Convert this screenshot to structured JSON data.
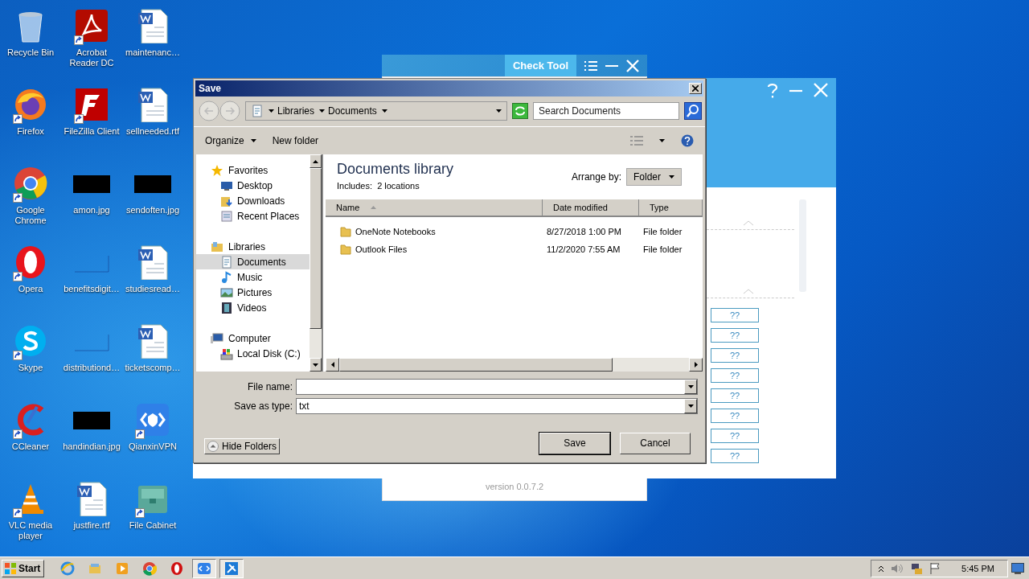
{
  "desktop_icons": [
    {
      "label": "Recycle Bin",
      "kind": "recycle",
      "shortcut": false
    },
    {
      "label": "Acrobat Reader DC",
      "kind": "pdf",
      "shortcut": true
    },
    {
      "label": "maintenanc…",
      "kind": "doc",
      "shortcut": false
    },
    {
      "label": "Firefox",
      "kind": "firefox",
      "shortcut": true
    },
    {
      "label": "FileZilla Client",
      "kind": "filezilla",
      "shortcut": true
    },
    {
      "label": "sellneeded.rtf",
      "kind": "doc",
      "shortcut": false
    },
    {
      "label": "Google Chrome",
      "kind": "chrome",
      "shortcut": true
    },
    {
      "label": "amon.jpg",
      "kind": "image",
      "shortcut": false
    },
    {
      "label": "sendoften.jpg",
      "kind": "image",
      "shortcut": false
    },
    {
      "label": "Opera",
      "kind": "opera",
      "shortcut": true
    },
    {
      "label": "benefitsdigit…",
      "kind": "blank",
      "shortcut": false
    },
    {
      "label": "studiesread…",
      "kind": "doc",
      "shortcut": false
    },
    {
      "label": "Skype",
      "kind": "skype",
      "shortcut": true
    },
    {
      "label": "distributiond…",
      "kind": "blank",
      "shortcut": false
    },
    {
      "label": "ticketscomp…",
      "kind": "doc",
      "shortcut": false
    },
    {
      "label": "CCleaner",
      "kind": "ccleaner",
      "shortcut": true
    },
    {
      "label": "handindian.jpg",
      "kind": "image",
      "shortcut": false
    },
    {
      "label": "QianxinVPN",
      "kind": "vpn",
      "shortcut": true
    },
    {
      "label": "VLC media player",
      "kind": "vlc",
      "shortcut": true
    },
    {
      "label": "justfire.rtf",
      "kind": "doc",
      "shortcut": false
    },
    {
      "label": "File Cabinet",
      "kind": "cabinet",
      "shortcut": true
    }
  ],
  "check_tool": {
    "title": "Check Tool",
    "version": "version 0.0.7.2"
  },
  "main_window": {
    "buttons": [
      "??",
      "??",
      "??",
      "??",
      "??",
      "??",
      "??",
      "??"
    ]
  },
  "save_dialog": {
    "title": "Save",
    "breadcrumb": [
      "Libraries",
      "Documents"
    ],
    "search": {
      "placeholder": "Search Documents"
    },
    "toolbar": [
      "Organize",
      "New folder"
    ],
    "nav": [
      {
        "label": "Favorites",
        "kind": "star",
        "children": [
          {
            "label": "Desktop",
            "kind": "desktop",
            "selected": false
          },
          {
            "label": "Downloads",
            "kind": "downloads",
            "selected": false
          },
          {
            "label": "Recent Places",
            "kind": "recent",
            "selected": false
          }
        ]
      },
      {
        "label": "Libraries",
        "kind": "library",
        "children": [
          {
            "label": "Documents",
            "kind": "documents",
            "selected": true
          },
          {
            "label": "Music",
            "kind": "music",
            "selected": false
          },
          {
            "label": "Pictures",
            "kind": "pictures",
            "selected": false
          },
          {
            "label": "Videos",
            "kind": "videos",
            "selected": false
          }
        ]
      },
      {
        "label": "Computer",
        "kind": "computer",
        "children": [
          {
            "label": "Local Disk (C:)",
            "kind": "disk",
            "selected": false
          }
        ]
      }
    ],
    "library": {
      "title": "Documents library",
      "subtitle": "Includes:  2 locations",
      "arrange_label": "Arrange by:",
      "arrange_value": "Folder"
    },
    "columns": [
      "Name",
      "Date modified",
      "Type"
    ],
    "rows": [
      {
        "name": "OneNote Notebooks",
        "date": "8/27/2018 1:00 PM",
        "type": "File folder"
      },
      {
        "name": "Outlook Files",
        "date": "11/2/2020 7:55 AM",
        "type": "File folder"
      }
    ],
    "file_name": {
      "label": "File name:"
    },
    "save_type": {
      "label": "Save as type:",
      "value": "txt"
    },
    "hide_folders": "Hide Folders",
    "buttons": [
      {
        "label": "Save",
        "default": true
      },
      {
        "label": "Cancel",
        "default": false
      }
    ]
  },
  "taskbar": {
    "start": "Start",
    "apps": [
      {
        "kind": "ie",
        "active": false
      },
      {
        "kind": "explorer",
        "active": false
      },
      {
        "kind": "media",
        "active": false
      },
      {
        "kind": "chrome",
        "active": false
      },
      {
        "kind": "opera",
        "active": false
      },
      {
        "kind": "vpn",
        "active": true
      },
      {
        "kind": "tool",
        "active": true
      }
    ],
    "clock": "5:45 PM"
  }
}
